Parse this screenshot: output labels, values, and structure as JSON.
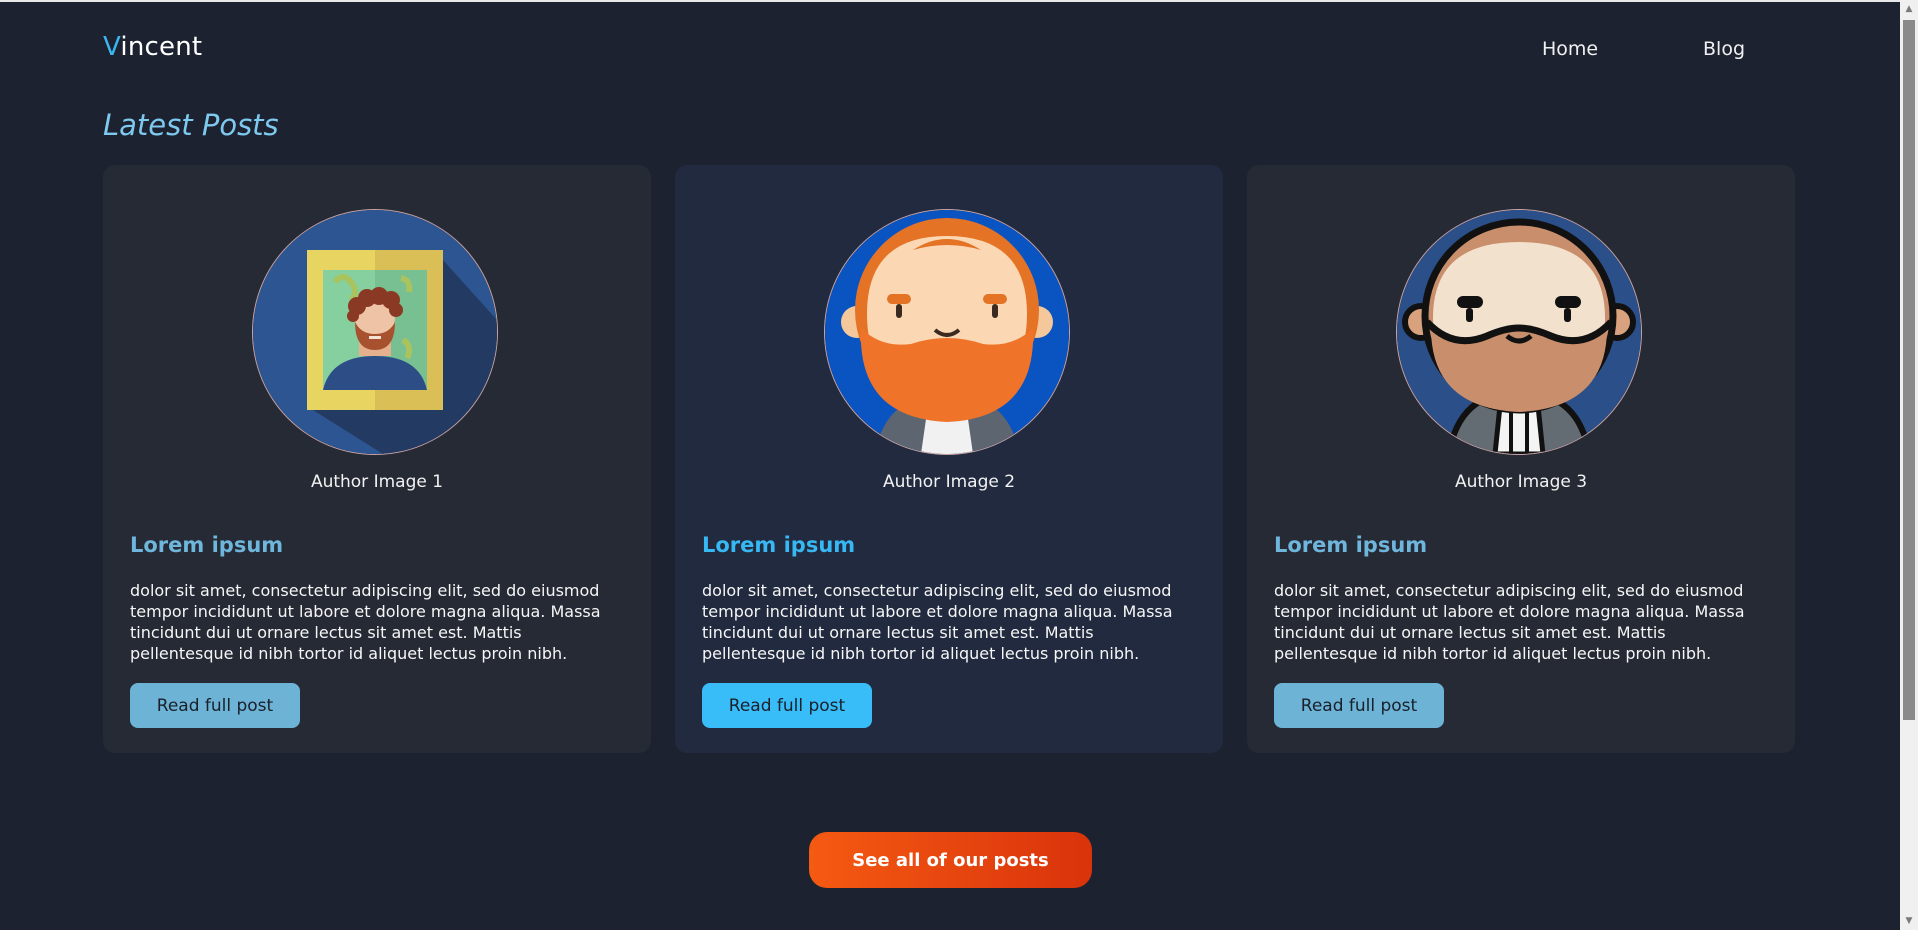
{
  "header": {
    "logo_first": "V",
    "logo_rest": "incent",
    "nav": [
      "Home",
      "Blog"
    ]
  },
  "section_title": "Latest Posts",
  "posts": [
    {
      "image_caption": "Author Image 1",
      "title": "Lorem ipsum",
      "body": "dolor sit amet, consectetur adipiscing elit, sed do eiusmod tempor incididunt ut labore et dolore magna aliqua. Massa tincidunt dui ut ornare lectus sit amet est. Mattis pellentesque id nibh tortor id aliquet lectus proin nibh.",
      "button": "Read full post"
    },
    {
      "image_caption": "Author Image 2",
      "title": "Lorem ipsum",
      "body": "dolor sit amet, consectetur adipiscing elit, sed do eiusmod tempor incididunt ut labore et dolore magna aliqua. Massa tincidunt dui ut ornare lectus sit amet est. Mattis pellentesque id nibh tortor id aliquet lectus proin nibh.",
      "button": "Read full post"
    },
    {
      "image_caption": "Author Image 3",
      "title": "Lorem ipsum",
      "body": "dolor sit amet, consectetur adipiscing elit, sed do eiusmod tempor incididunt ut labore et dolore magna aliqua. Massa tincidunt dui ut ornare lectus sit amet est. Mattis pellentesque id nibh tortor id aliquet lectus proin nibh.",
      "button": "Read full post"
    }
  ],
  "see_all_button": "See all of our posts",
  "colors": {
    "background": "#1d2230",
    "accent_blue": "#38bdf8",
    "accent_orange": "#f55a12",
    "card": "#252a35"
  },
  "icons": {
    "avatar_1": "framed-portrait-icon",
    "avatar_2": "bearded-man-icon",
    "avatar_3": "mustached-man-icon"
  }
}
